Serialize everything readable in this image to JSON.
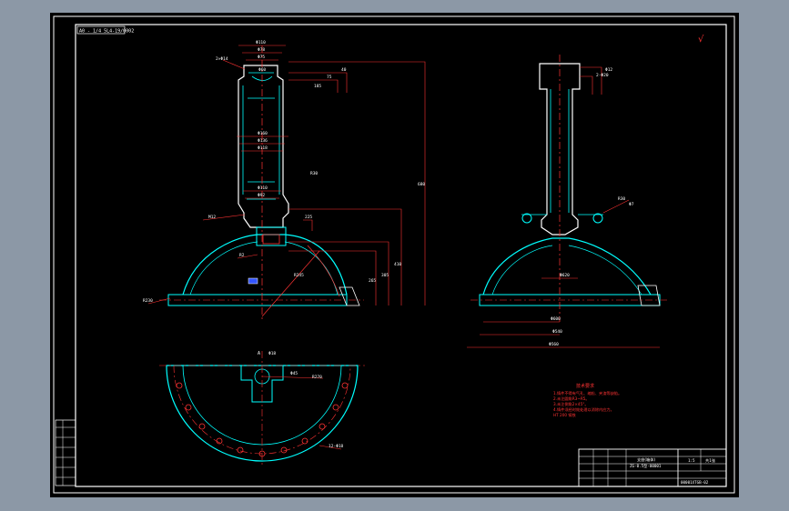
{
  "drawing": {
    "corner_tag": "A0 - 1/4 5L4-19/0002",
    "roughness_mark": "√",
    "front_view": {
      "top_dims": [
        "Φ110",
        "Φ78",
        "Φ75",
        "Φ60"
      ],
      "waist_dims": [
        "Φ160",
        "Φ136",
        "Φ118",
        "Φ110",
        "Φ92"
      ],
      "vertical_dims": [
        "40",
        "75",
        "680",
        "410",
        "305",
        "265",
        "225",
        "185"
      ],
      "notes": [
        "2×Φ14",
        "M12",
        "R230",
        "R2",
        "R245",
        "R30"
      ]
    },
    "side_view": {
      "dims": [
        "Φ600",
        "Φ540",
        "Φ560",
        "Φ620",
        "2-Φ20"
      ],
      "notes": [
        "R30",
        "Φ7",
        "Φ12"
      ]
    },
    "plan_view": {
      "dims": [
        "Φ45",
        "R270",
        "Φ18",
        "12-Φ18"
      ],
      "notes": [
        "A"
      ]
    },
    "tech_requirements": {
      "title": "技术要求",
      "lines": [
        "1.铸件不得有气孔、缩松、夹渣等缺陷。",
        "2.未注圆角R3~R5。",
        "3.未注倒角2×45°。",
        "4.铸件须经时效处理以消除内应力。",
        "  HT 200 铸铁"
      ]
    },
    "title_block": {
      "name": "支座(箱体)",
      "material": "ZG-0.5型-00001",
      "drawing_no": "00001XTGB-02",
      "scale": "1:5",
      "sheet": "共1张"
    },
    "revision_block": {
      "rows": [
        "",
        "",
        "",
        "",
        "",
        ""
      ]
    }
  }
}
